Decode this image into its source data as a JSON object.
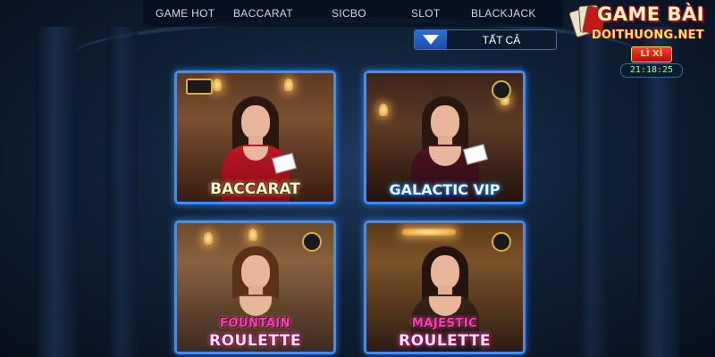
{
  "nav": {
    "tabs": [
      {
        "label": "GAME HOT"
      },
      {
        "label": "BACCARAT"
      },
      {
        "label": "SICBO"
      },
      {
        "label": "SLOT"
      },
      {
        "label": "BLACKJACK"
      }
    ]
  },
  "filter": {
    "selected": "TẤT CẢ",
    "icon": "dropdown-triangle-icon"
  },
  "brand": {
    "line1": "GAME BÀI",
    "line2": "DOITHUONG.NET",
    "lixi": "LÌ XÌ",
    "timer": "21:18:25"
  },
  "games": [
    {
      "title": "BACCARAT"
    },
    {
      "title": "GALACTIC VIP"
    },
    {
      "subtitle": "FOUNTAIN",
      "title": "ROULETTE"
    },
    {
      "subtitle": "MAJESTIC",
      "title": "ROULETTE"
    }
  ],
  "colors": {
    "tile_border": "#3c8dff",
    "accent_pink": "#ff3fb2",
    "filter_blue": "#2c6fd6"
  }
}
